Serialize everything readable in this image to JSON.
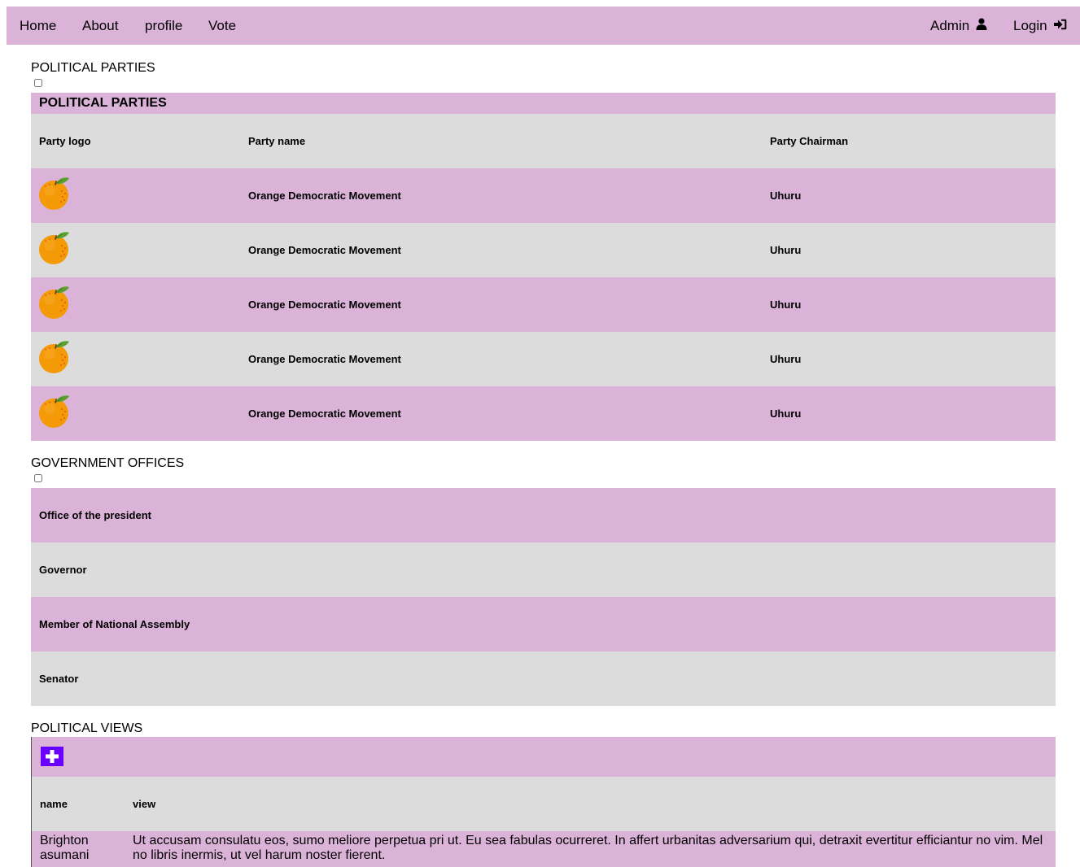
{
  "nav": {
    "home": "Home",
    "about": "About",
    "profile": "profile",
    "vote": "Vote",
    "admin": "Admin",
    "login": "Login",
    "admin_icon": "user-icon",
    "login_icon": "sign-in-icon"
  },
  "colors": {
    "pink": "#dbb3d8",
    "grey": "#dcdcdc",
    "accent": "#6a00ff"
  },
  "parties": {
    "section_title": "POLITICAL PARTIES",
    "caption": "POLITICAL PARTIES",
    "headers": {
      "logo": "Party logo",
      "name": "Party name",
      "chairman": "Party Chairman"
    },
    "logo_icon": "orange-icon",
    "rows": [
      {
        "name": "Orange Democratic Movement",
        "chairman": "Uhuru"
      },
      {
        "name": "Orange Democratic Movement",
        "chairman": "Uhuru"
      },
      {
        "name": "Orange Democratic Movement",
        "chairman": "Uhuru"
      },
      {
        "name": "Orange Democratic Movement",
        "chairman": "Uhuru"
      },
      {
        "name": "Orange Democratic Movement",
        "chairman": "Uhuru"
      }
    ]
  },
  "offices": {
    "section_title": "GOVERNMENT OFFICES",
    "items": [
      "Office of the president",
      "Governor",
      "Member of National Assembly",
      "Senator"
    ]
  },
  "views": {
    "section_title": "POLITICAL VIEWS",
    "add_icon": "plus-icon",
    "headers": {
      "name": "name",
      "view": "view"
    },
    "rows": [
      {
        "name": "Brighton asumani",
        "view": "Ut accusam consulatu eos, sumo meliore perpetua pri ut. Eu sea fabulas ocurreret. In affert urbanitas adversarium qui, detraxit evertitur efficiantur no vim. Mel no libris inermis, ut vel harum noster fierent."
      }
    ]
  }
}
